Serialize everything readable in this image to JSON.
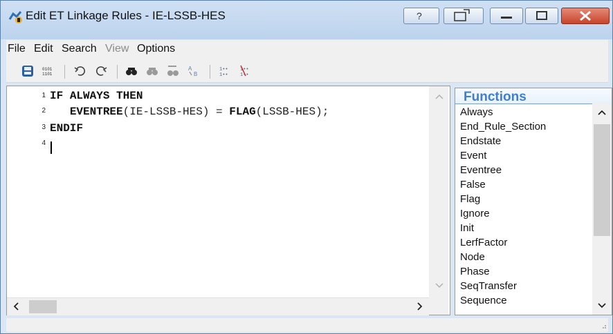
{
  "window": {
    "title": "Edit ET Linkage Rules - IE-LSSB-HES"
  },
  "menu": [
    "File",
    "Edit",
    "Search",
    "View",
    "Options"
  ],
  "menu_disabled_index": 3,
  "toolbar_icons": [
    "save-icon",
    "compile-icon",
    "undo-icon",
    "redo-icon",
    "find-icon",
    "find-next-icon",
    "replace-icon",
    "replace-all-icon",
    "insert-icon",
    "delete-icon"
  ],
  "editor": {
    "line_numbers": [
      "1",
      "2",
      "3",
      "4"
    ],
    "line1": {
      "kw1": "IF",
      "kw2": "ALWAYS",
      "kw3": "THEN"
    },
    "line2": {
      "func1": "EVENTREE",
      "arg1": "(IE-LSSB-HES)",
      "op": " = ",
      "func2": "FLAG",
      "arg2": "(LSSB-HES);"
    },
    "line3": {
      "kw": "ENDIF"
    }
  },
  "functions": {
    "title": "Functions",
    "items": [
      "Always",
      "End_Rule_Section",
      "Endstate",
      "Event",
      "Eventree",
      "False",
      "Flag",
      "Ignore",
      "Init",
      "LerfFactor",
      "Node",
      "Phase",
      "SeqTransfer",
      "Sequence"
    ]
  },
  "colors": {
    "accent": "#3f7fd0",
    "titlebar": "#cfe0f3",
    "close": "#c7442b"
  }
}
